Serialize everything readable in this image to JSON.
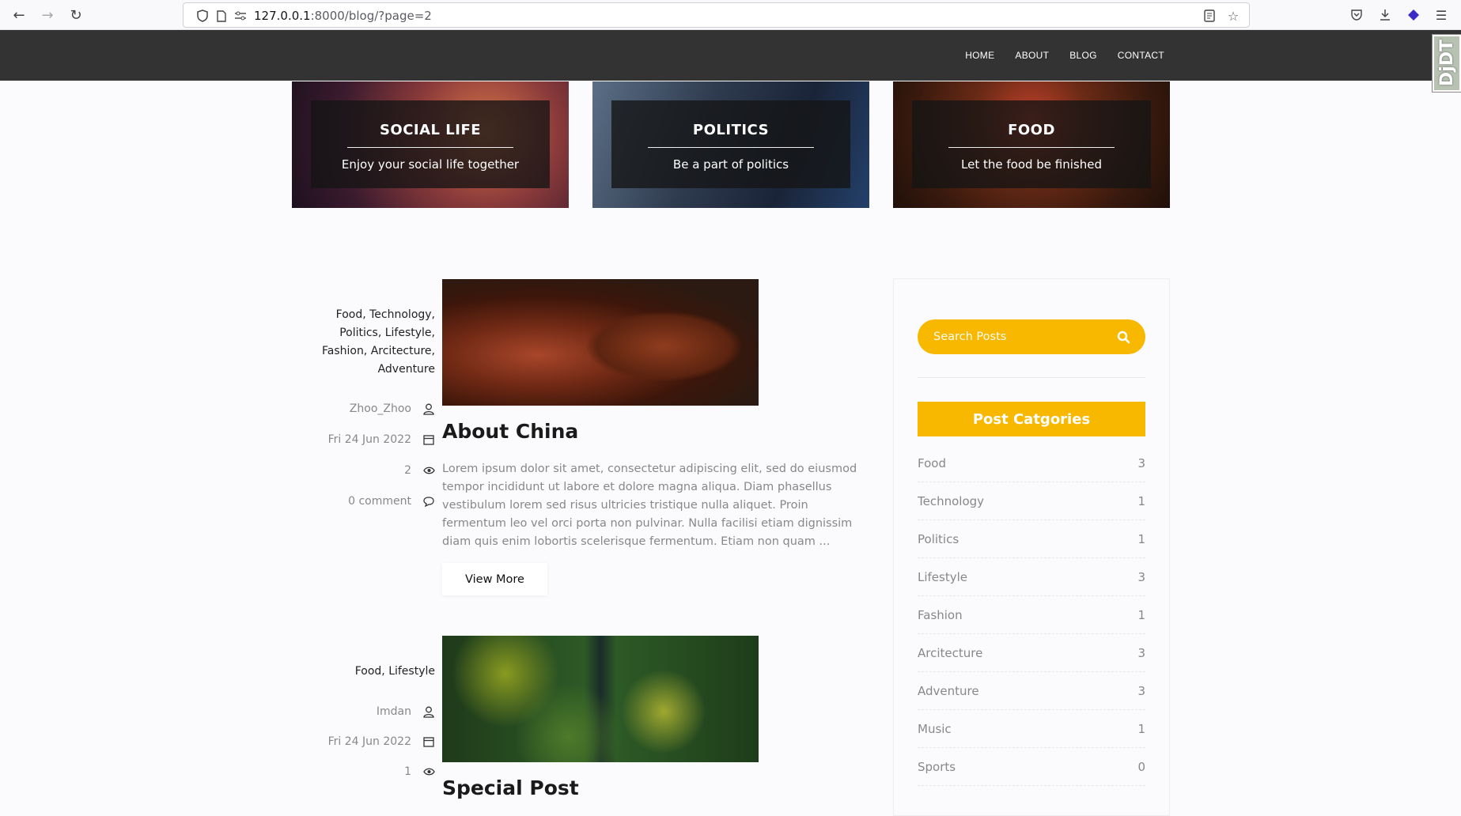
{
  "browser": {
    "url_host": "127.0.0.1",
    "url_rest": ":8000/blog/?page=2"
  },
  "nav": {
    "items": [
      "HOME",
      "ABOUT",
      "BLOG",
      "CONTACT"
    ]
  },
  "debug_toolbar": {
    "label": "DjDT"
  },
  "tiles": [
    {
      "title": "SOCIAL LIFE",
      "subtitle": "Enjoy your social life together"
    },
    {
      "title": "POLITICS",
      "subtitle": "Be a part of politics"
    },
    {
      "title": "FOOD",
      "subtitle": "Let the food be finished"
    }
  ],
  "posts": [
    {
      "categories": [
        "Food,",
        "Technology,",
        "Politics,",
        "Lifestyle,",
        "Fashion,",
        "Arcitecture,",
        "Adventure"
      ],
      "categories_lines": [
        "Food, Technology,",
        "Politics, Lifestyle,",
        "Fashion, Arcitecture,",
        "Adventure"
      ],
      "author": "Zhoo_Zhoo",
      "date": "Fri 24 Jun 2022",
      "views": "2",
      "comments": "0 comment",
      "title": "About China",
      "excerpt": "Lorem ipsum dolor sit amet, consectetur adipiscing elit, sed do eiusmod tempor incididunt ut labore et dolore magna aliqua. Diam phasellus vestibulum lorem sed risus ultricies tristique nulla aliquet. Proin fermentum leo vel orci porta non pulvinar. Nulla facilisi etiam dignissim diam quis enim lobortis scelerisque fermentum. Etiam non quam ...",
      "button": "View More"
    },
    {
      "categories_lines": [
        "Food, Lifestyle"
      ],
      "author": "Imdan",
      "date": "Fri 24 Jun 2022",
      "views": "1",
      "title": "Special Post"
    }
  ],
  "sidebar": {
    "search_placeholder": "Search Posts",
    "heading": "Post Catgories",
    "categories": [
      {
        "name": "Food",
        "count": "3"
      },
      {
        "name": "Technology",
        "count": "1"
      },
      {
        "name": "Politics",
        "count": "1"
      },
      {
        "name": "Lifestyle",
        "count": "3"
      },
      {
        "name": "Fashion",
        "count": "1"
      },
      {
        "name": "Arcitecture",
        "count": "3"
      },
      {
        "name": "Adventure",
        "count": "3"
      },
      {
        "name": "Music",
        "count": "1"
      },
      {
        "name": "Sports",
        "count": "0"
      }
    ]
  },
  "colors": {
    "accent": "#f8b800",
    "header_bg": "#333333"
  }
}
